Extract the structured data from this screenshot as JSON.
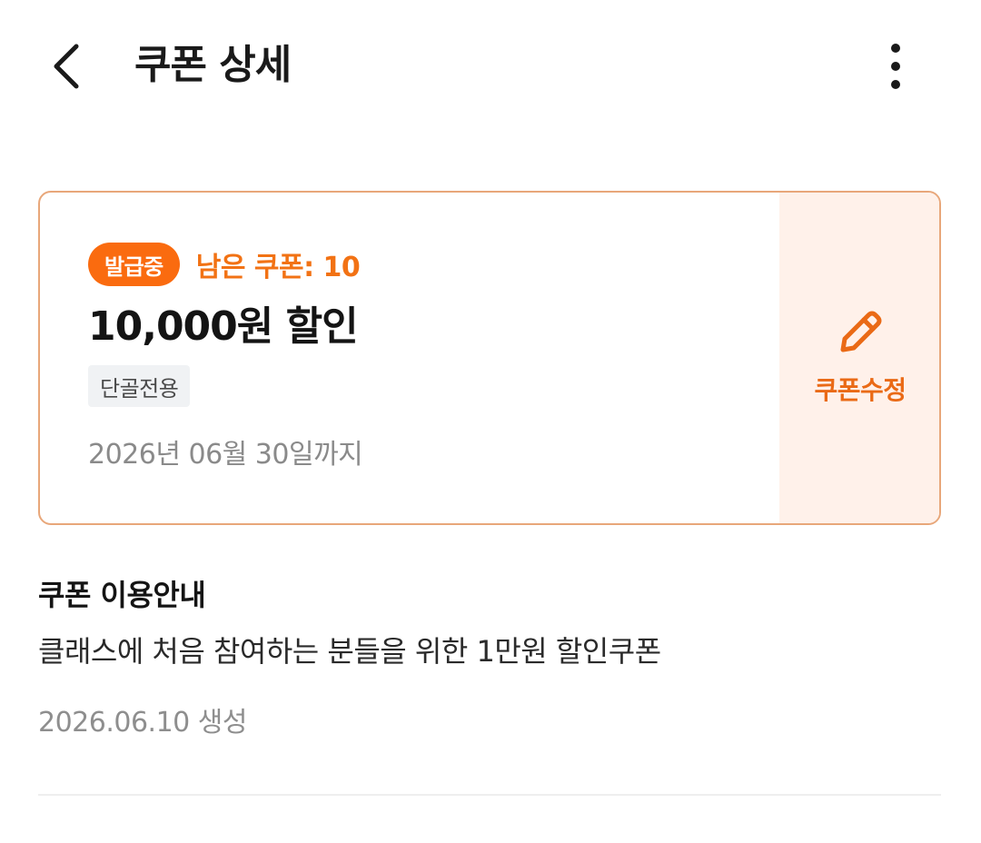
{
  "header": {
    "title": "쿠폰 상세",
    "back_icon": "chevron-left-icon",
    "more_icon": "more-vertical-icon"
  },
  "coupon": {
    "status_badge": "발급중",
    "remaining": "남은 쿠폰: 10",
    "discount": "10,000원 할인",
    "tag": "단골전용",
    "expiry": "2026년 06월 30일까지",
    "edit_icon": "pencil-icon",
    "edit_label": "쿠폰수정"
  },
  "info": {
    "title": "쿠폰 이용안내",
    "description": "클래스에 처음 참여하는 분들을 위한 1만원 할인쿠폰",
    "created": "2026.06.10 생성"
  },
  "colors": {
    "accent": "#fa6b0f",
    "accent_text": "#f27214",
    "card_border": "#e8a77a",
    "edit_bg": "#fff1ea"
  }
}
